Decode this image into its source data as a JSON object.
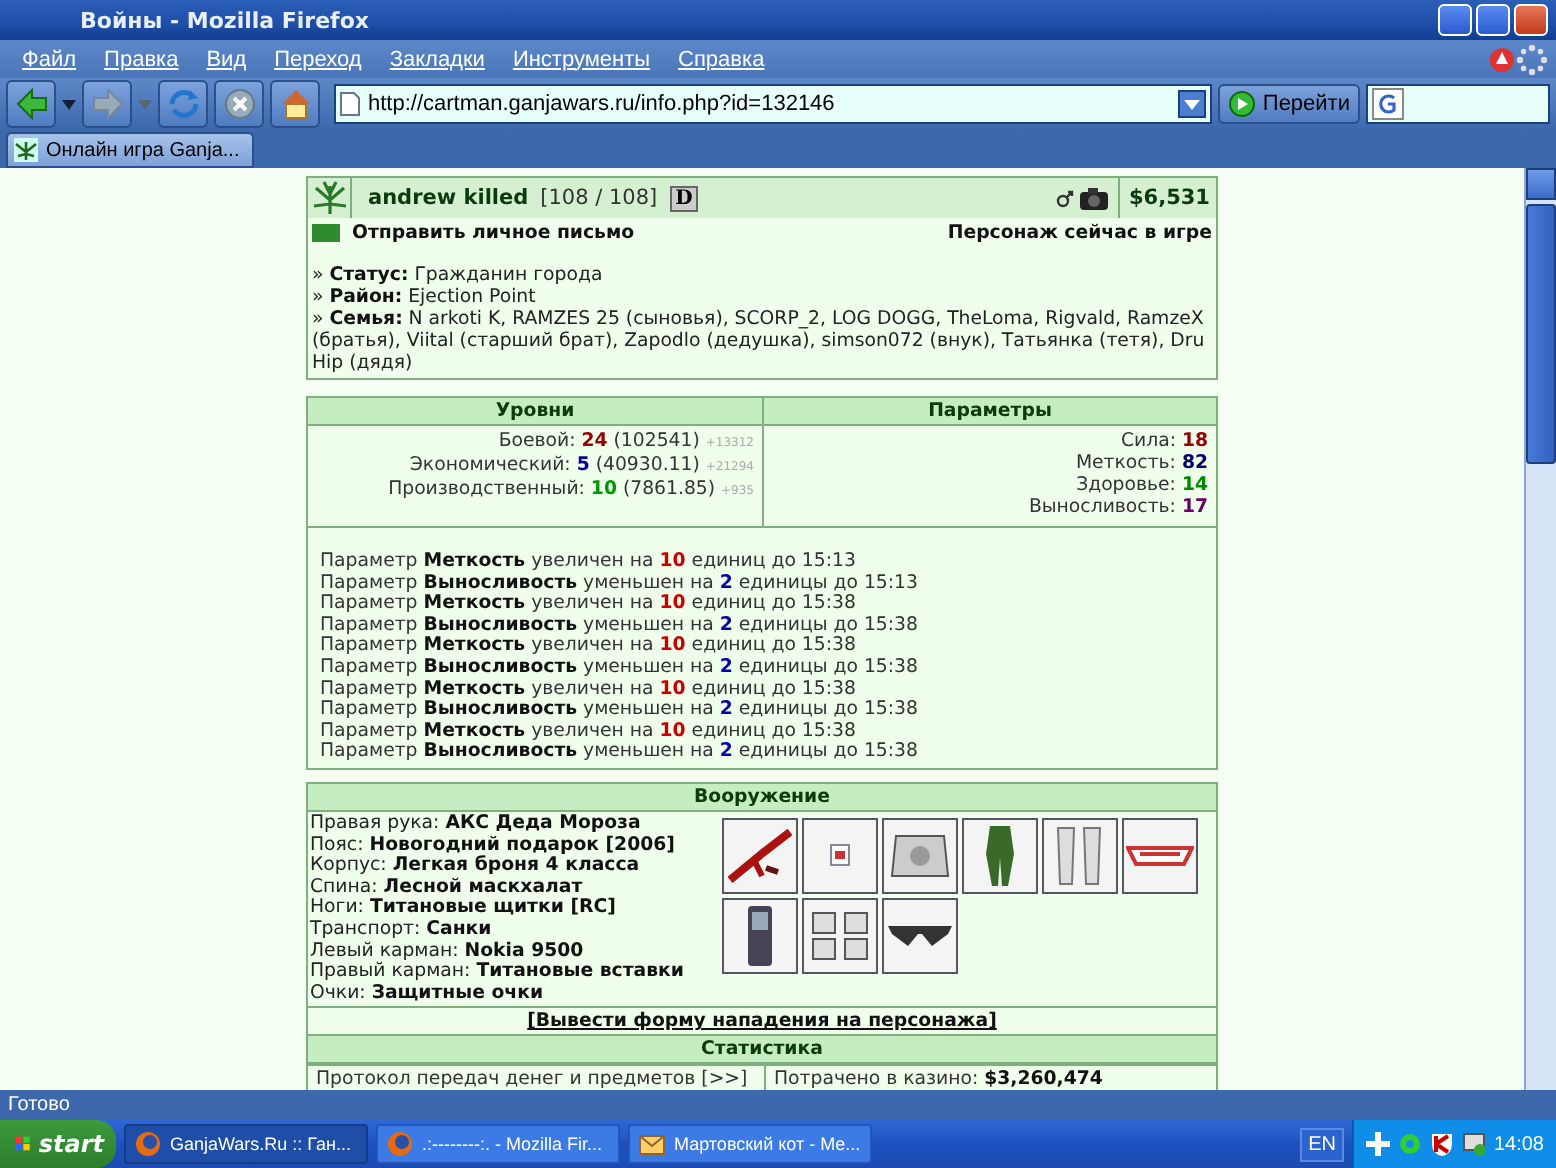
{
  "window": {
    "title": "Войны - Mozilla Firefox"
  },
  "menu": [
    {
      "label": "Файл"
    },
    {
      "label": "Правка"
    },
    {
      "label": "Вид"
    },
    {
      "label": "Переход"
    },
    {
      "label": "Закладки"
    },
    {
      "label": "Инструменты"
    },
    {
      "label": "Справка"
    }
  ],
  "toolbar": {
    "address": "http://cartman.ganjawars.ru/info.php?id=132146",
    "go_button": "Перейти"
  },
  "tabs": [
    {
      "label": "Онлайн игра Ganja...",
      "selected": true
    }
  ],
  "profile": {
    "name": "andrew killed",
    "hp": "[108 / 108]",
    "badge": "D",
    "money": "$6,531",
    "message_link": "Отправить личное письмо",
    "online_status": "Персонаж сейчас в игре",
    "info": [
      "» **Статус:** Гражданин города",
      "» **Район:** Ejection Point",
      "» **Семья:** N arkoti K, RAMZES 25 (сыновья), SCORP_2, LOG DOGG, TheLoma, Rigvald, RamzeX (братья), Viital (старший брат), Zapodlo (дедушка), simson072 (внук), Татьянка (тетя), Dru Hip (дядя)"
    ]
  },
  "levels": {
    "header": "Уровни",
    "items": [
      {
        "label": "Боевой:",
        "level": "24",
        "exp": "(102541)",
        "gain": "+13312",
        "color": "#990000"
      },
      {
        "label": "Экономический:",
        "level": "5",
        "exp": "(40930.11)",
        "gain": "+21294",
        "color": "#000099"
      },
      {
        "label": "Производственный:",
        "level": "10",
        "exp": "(7861.85)",
        "gain": "+935",
        "color": "#009900"
      }
    ]
  },
  "params": {
    "header": "Параметры",
    "items": [
      {
        "label": "Сила:",
        "value": "18",
        "color": "#990000"
      },
      {
        "label": "Меткость:",
        "value": "82",
        "color": "#000066"
      },
      {
        "label": "Здоровье:",
        "value": "14",
        "color": "#008800"
      },
      {
        "label": "Выносливость:",
        "value": "17",
        "color": "#660066"
      }
    ]
  },
  "effects": [
    {
      "kind": "up",
      "prefix": "Параметр",
      "param": "Меткость",
      "change": "увеличен на",
      "amount": "10",
      "rest": "единиц до 15:13"
    },
    {
      "kind": "down",
      "prefix": "Параметр",
      "param": "Выносливость",
      "change": "уменьшен на",
      "amount": "2",
      "rest": "единицы до 15:13"
    },
    {
      "kind": "up",
      "prefix": "Параметр",
      "param": "Меткость",
      "change": "увеличен на",
      "amount": "10",
      "rest": "единиц до 15:38"
    },
    {
      "kind": "down",
      "prefix": "Параметр",
      "param": "Выносливость",
      "change": "уменьшен на",
      "amount": "2",
      "rest": "единицы до 15:38"
    },
    {
      "kind": "up",
      "prefix": "Параметр",
      "param": "Меткость",
      "change": "увеличен на",
      "amount": "10",
      "rest": "единиц до 15:38"
    },
    {
      "kind": "down",
      "prefix": "Параметр",
      "param": "Выносливость",
      "change": "уменьшен на",
      "amount": "2",
      "rest": "единицы до 15:38"
    },
    {
      "kind": "up",
      "prefix": "Параметр",
      "param": "Меткость",
      "change": "увеличен на",
      "amount": "10",
      "rest": "единиц до 15:38"
    },
    {
      "kind": "down",
      "prefix": "Параметр",
      "param": "Выносливость",
      "change": "уменьшен на",
      "amount": "2",
      "rest": "единицы до 15:38"
    },
    {
      "kind": "up",
      "prefix": "Параметр",
      "param": "Меткость",
      "change": "увеличен на",
      "amount": "10",
      "rest": "единиц до 15:38"
    },
    {
      "kind": "down",
      "prefix": "Параметр",
      "param": "Выносливость",
      "change": "уменьшен на",
      "amount": "2",
      "rest": "единицы до 15:38"
    }
  ],
  "equipment": {
    "header": "Вооружение",
    "slots": [
      {
        "label": "Правая рука:",
        "value": "АКС Деда Мороза"
      },
      {
        "label": "Пояс:",
        "value": "Новогодний подарок [2006]"
      },
      {
        "label": "Корпус:",
        "value": "Легкая броня 4 класса"
      },
      {
        "label": "Спина:",
        "value": "Лесной маскхалат"
      },
      {
        "label": "Ноги:",
        "value": "Титановые щитки [RC]"
      },
      {
        "label": "Транспорт:",
        "value": "Санки"
      },
      {
        "label": "Левый карман:",
        "value": "Nokia 9500"
      },
      {
        "label": "Правый карман:",
        "value": "Титановые вставки"
      },
      {
        "label": "Очки:",
        "value": "Защитные очки"
      }
    ]
  },
  "attack_link": "[Вывести форму нападения на персонажа]",
  "stats": {
    "header": "Статистика",
    "left": "Протокол передач денег и предметов [>>]",
    "right_label": "Потрачено в казино:",
    "right_value": "$3,260,474"
  },
  "status_bar": "Готово",
  "taskbar": {
    "start": "start",
    "tasks": [
      {
        "label": "GanjaWars.Ru :: Ган...",
        "kind": "browser",
        "selected": true
      },
      {
        "label": ".:--------:. - Mozilla Fir...",
        "kind": "browser",
        "selected": false
      },
      {
        "label": "Мартовский кот - Ме...",
        "kind": "mail",
        "selected": false
      }
    ],
    "language": "EN",
    "clock": "14:08"
  }
}
